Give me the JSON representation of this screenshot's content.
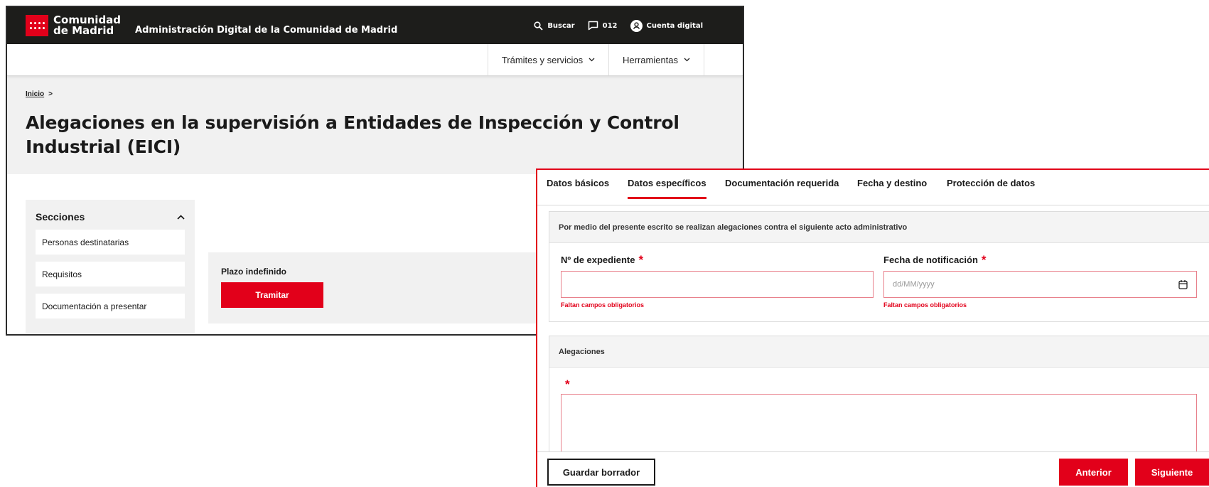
{
  "back_window": {
    "logo": {
      "line1": "Comunidad",
      "line2": "de Madrid"
    },
    "admin_title": "Administración Digital de la Comunidad de Madrid",
    "top_actions": {
      "search": "Buscar",
      "phone": "012",
      "account": "Cuenta digital"
    },
    "menu": [
      {
        "label": "Trámites y servicios"
      },
      {
        "label": "Herramientas"
      }
    ],
    "breadcrumb": {
      "home": "Inicio",
      "separator": ">"
    },
    "page_title": "Alegaciones en la supervisión a Entidades de Inspección y Control Industrial (EICI)",
    "sections": {
      "title": "Secciones",
      "items": [
        "Personas destinatarias",
        "Requisitos",
        "Documentación a presentar"
      ]
    },
    "plazo": {
      "label": "Plazo indefinido",
      "button": "Tramitar"
    }
  },
  "front_window": {
    "tabs": [
      {
        "label": "Datos básicos",
        "active": false
      },
      {
        "label": "Datos específicos",
        "active": true
      },
      {
        "label": "Documentación requerida",
        "active": false
      },
      {
        "label": "Fecha y destino",
        "active": false
      },
      {
        "label": "Protección de datos",
        "active": false
      }
    ],
    "panel1": {
      "heading": "Por medio del presente escrito se realizan alegaciones contra el siguiente acto administrativo",
      "expediente": {
        "label": "Nº de expediente",
        "required_mark": "*",
        "value": "",
        "error": "Faltan campos obligatorios"
      },
      "fecha": {
        "label": "Fecha de notificación",
        "required_mark": "*",
        "placeholder": "dd/MM/yyyy",
        "error": "Faltan campos obligatorios"
      }
    },
    "panel2": {
      "heading": "Alegaciones",
      "required_mark": "*"
    },
    "footer": {
      "save_draft": "Guardar borrador",
      "previous": "Anterior",
      "next": "Siguiente"
    }
  },
  "colors": {
    "brand_red": "#e2001a",
    "topbar_black": "#1d1d1b",
    "panel_grey": "#f1f1f1"
  }
}
